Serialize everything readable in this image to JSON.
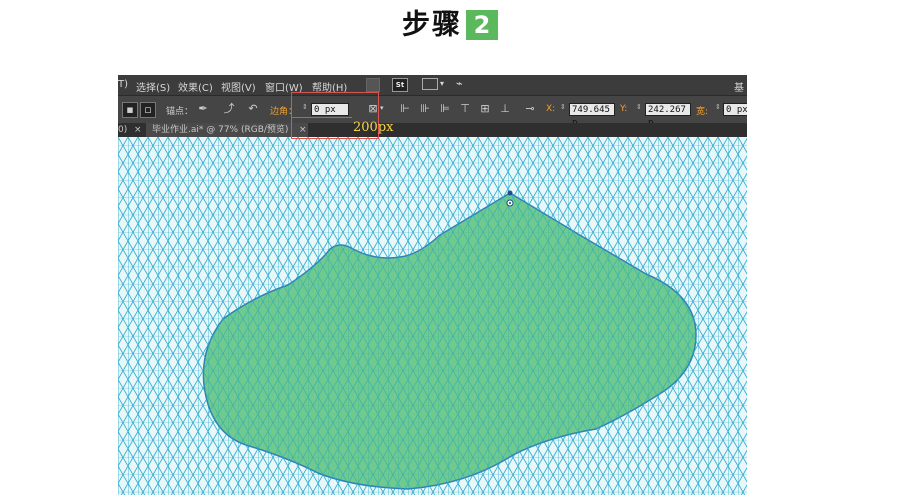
{
  "step": {
    "title": "步骤",
    "number": "2"
  },
  "menubar": {
    "items": [
      "T)",
      "选择(S)",
      "效果(C)",
      "视图(V)",
      "窗口(W)",
      "帮助(H)"
    ],
    "st_label": "St",
    "workspace_label": "基"
  },
  "control_bar": {
    "anchor_label": "锚点：",
    "corner_label": "边角：",
    "corner_value": "0 px",
    "x_label": "X:",
    "x_value": "749.645 p",
    "y_label": "Y:",
    "y_value": "242.267 p",
    "w_label": "宽:",
    "w_value": "0 px"
  },
  "tabs": {
    "prev_tab": "0)",
    "prev_close": "×",
    "doc_tab": "毕业作业.ai* @ 77% (RGB/预览)",
    "doc_close": "×"
  },
  "annotation": {
    "label": "200px"
  },
  "colors": {
    "grid_line": "#29a9cf",
    "canvas_bg": "#e9f7f9",
    "shape_fill": "#5cc27a",
    "shape_stroke": "#2f82b5",
    "step_badge": "#5cb85c",
    "callout": "#d9534f",
    "callout_text": "#f5d34a"
  }
}
